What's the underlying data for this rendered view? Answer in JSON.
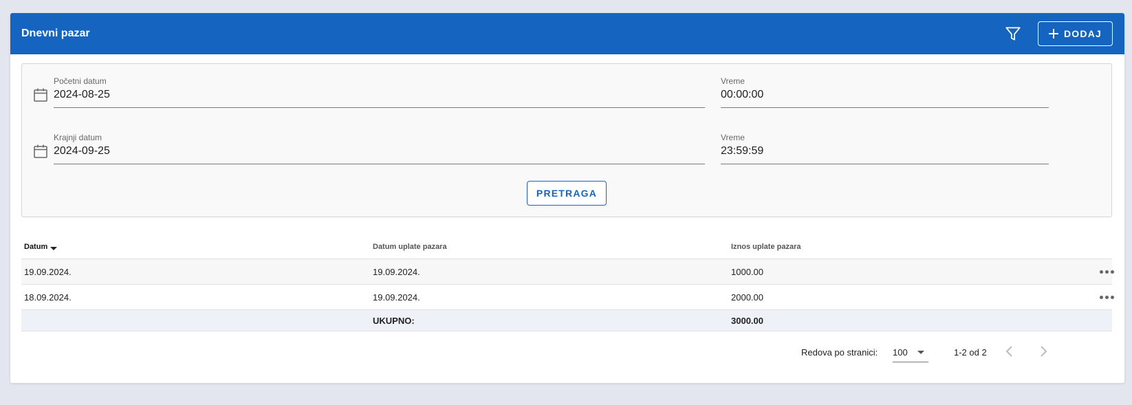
{
  "header": {
    "title": "Dnevni pazar",
    "add_label": "DODAJ",
    "color": "#1565c0"
  },
  "filters": {
    "start_date": {
      "label": "Početni datum",
      "value": "2024-08-25"
    },
    "start_time": {
      "label": "Vreme",
      "value": "00:00:00"
    },
    "end_date": {
      "label": "Krajnji datum",
      "value": "2024-09-25"
    },
    "end_time": {
      "label": "Vreme",
      "value": "23:59:59"
    },
    "search_label": "PRETRAGA"
  },
  "table": {
    "columns": [
      "Datum",
      "Datum uplate pazara",
      "Iznos uplate pazara"
    ],
    "rows": [
      [
        "19.09.2024.",
        "19.09.2024.",
        "1000.00"
      ],
      [
        "18.09.2024.",
        "19.09.2024.",
        "2000.00"
      ]
    ],
    "total_label": "UKUPNO:",
    "total_value": "3000.00"
  },
  "pagination": {
    "rows_per_page_label": "Redova po stranici:",
    "rows_per_page": "100",
    "range": "1-2 od 2"
  }
}
